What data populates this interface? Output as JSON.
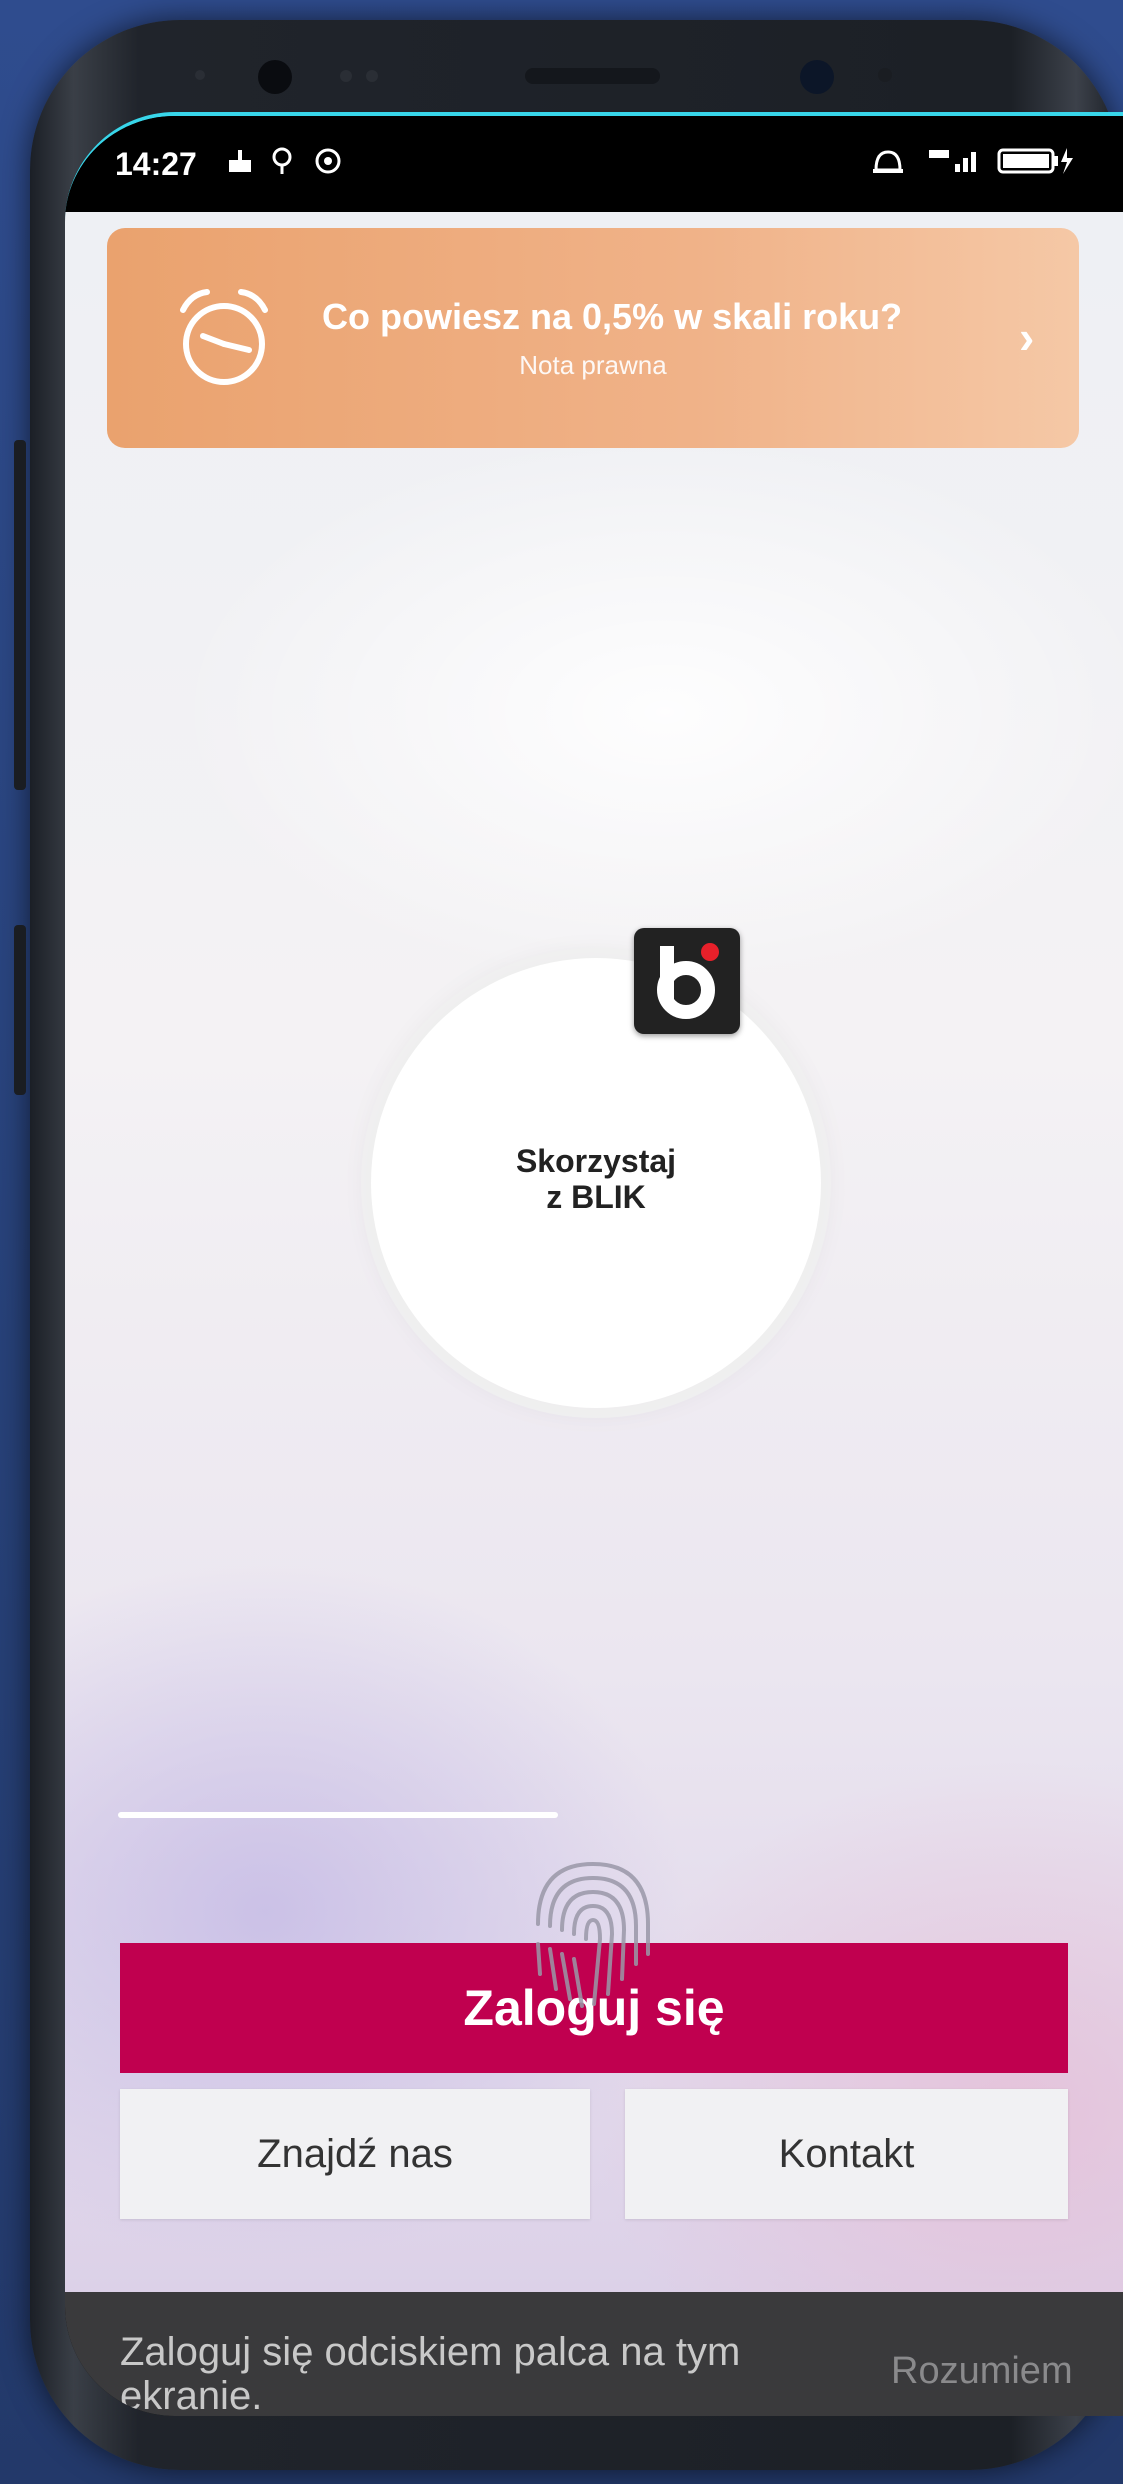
{
  "status": {
    "time": "14:27",
    "icons": [
      "cake-icon",
      "location-icon",
      "data-saver-icon",
      "alarm-icon",
      "volte-signal-icon",
      "battery-icon"
    ],
    "battery": "99"
  },
  "promo": {
    "title": "Co powiesz na 0,5% w skali roku?",
    "subtitle": "Nota prawna",
    "icon": "alarm-clock-icon",
    "arrow": "›"
  },
  "blik": {
    "label_line1": "Skorzystaj",
    "label_line2": "z BLIK",
    "logo_letter": "b"
  },
  "actions": {
    "login": "Zaloguj się",
    "find_us": "Znajdź nas",
    "contact": "Kontakt"
  },
  "snackbar": {
    "message": "Zaloguj się odciskiem palca na tym ekranie.",
    "action": "Rozumiem"
  },
  "colors": {
    "accent": "#c0004f",
    "promo": "#eaa26e",
    "snackbar": "#3a3a3c"
  }
}
